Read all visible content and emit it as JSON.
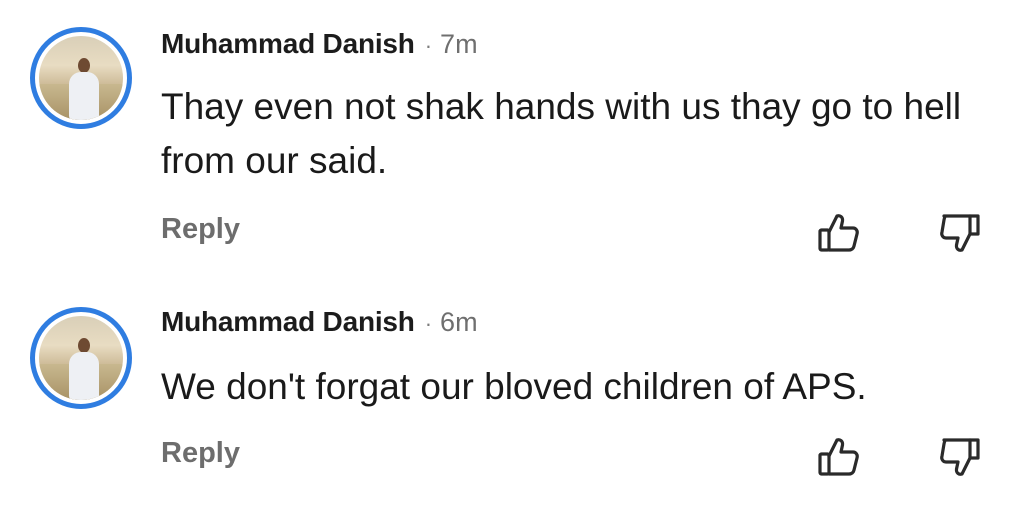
{
  "comments": [
    {
      "author": "Muhammad Danish",
      "separator": "·",
      "time": "7m",
      "text": "Thay even not shak hands with us thay go to hell from our said.",
      "reply_label": "Reply",
      "like_icon": "thumbs-up-icon",
      "dislike_icon": "thumbs-down-icon"
    },
    {
      "author": "Muhammad Danish",
      "separator": "·",
      "time": "6m",
      "text": "We don't forgat our bloved children of APS.",
      "reply_label": "Reply",
      "like_icon": "thumbs-up-icon",
      "dislike_icon": "thumbs-down-icon"
    }
  ],
  "colors": {
    "avatar_ring": "#2f7de1",
    "meta_text": "#6f6f6f",
    "icon_stroke": "#2a2a2a"
  }
}
